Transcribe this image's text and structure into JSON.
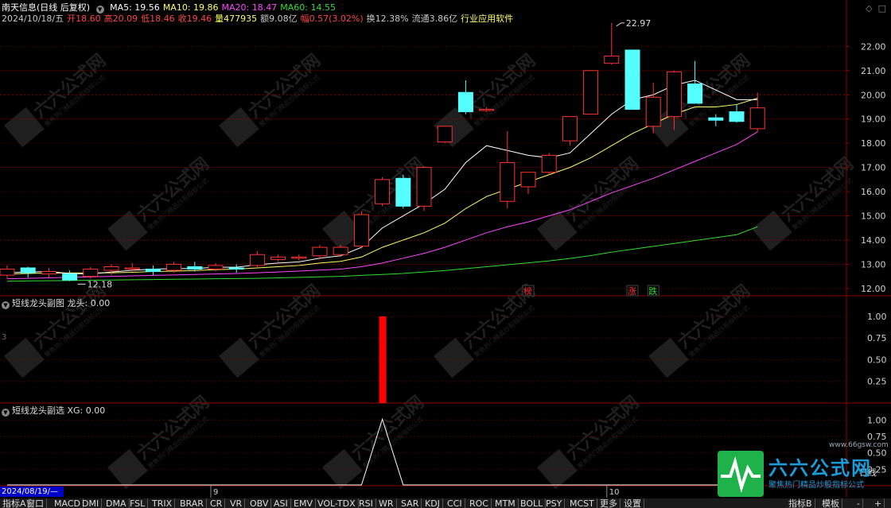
{
  "header": {
    "title": "南天信息(日线 后复权)",
    "ma": [
      {
        "label": "MA5: 19.56",
        "color": "#ffffff"
      },
      {
        "label": "MA10: 19.86",
        "color": "#ffff66"
      },
      {
        "label": "MA20: 18.47",
        "color": "#ff44ff"
      },
      {
        "label": "MA60: 14.55",
        "color": "#33dd33"
      }
    ],
    "line2": [
      {
        "label": "2024/10/18/五",
        "color": "#c8c8c8"
      },
      {
        "label": "开18.60",
        "color": "#ff4444"
      },
      {
        "label": "高20.09",
        "color": "#ff4444"
      },
      {
        "label": "低18.46",
        "color": "#ff4444"
      },
      {
        "label": "收19.46",
        "color": "#ff4444"
      },
      {
        "label": "量477935",
        "color": "#ffff66"
      },
      {
        "label": "额9.08亿",
        "color": "#c8c8c8"
      },
      {
        "label": "幅0.57(3.02%)",
        "color": "#ff4444"
      },
      {
        "label": "换12.38%",
        "color": "#c8c8c8"
      },
      {
        "label": "流通3.86亿",
        "color": "#c8c8c8"
      },
      {
        "label": "行业应用软件",
        "color": "#ffff66"
      }
    ]
  },
  "corner_icons": [
    "◇",
    "□"
  ],
  "sub1": {
    "title": "短线龙头副图",
    "value": "龙头: 0.00",
    "left_mark": "3"
  },
  "sub2": {
    "title": "短线龙头副选",
    "value": "XG: 0.00"
  },
  "price_labels": {
    "high": "22.97",
    "low": "12.18"
  },
  "markers": [
    {
      "text": "榜",
      "color": "#ff3333",
      "at": 25
    },
    {
      "text": "涨",
      "color": "#ff3333",
      "at": 30
    },
    {
      "text": "跌",
      "color": "#33dd33",
      "at": 31
    }
  ],
  "date_box": "2024/08/19/—",
  "month_labels": [
    {
      "text": "9",
      "at": 10
    },
    {
      "text": "10",
      "at": 29
    }
  ],
  "daily_label": "日线",
  "tabs": [
    "指标A",
    "窗口",
    "MACD",
    "DMI",
    "DMA",
    "FSL",
    "TRIX",
    "BRAR",
    "CR",
    "VR",
    "OBV",
    "ASI",
    "EMV",
    "VOL-TDX",
    "RSI",
    "WR",
    "SAR",
    "KDJ",
    "CCI",
    "ROC",
    "MTM",
    "BOLL",
    "PSY",
    "MCST",
    "更多",
    "设置"
  ],
  "right_tabs": [
    "指标B",
    "模板"
  ],
  "logo": {
    "main": "六六公式网",
    "sub": "聚焦热门精品炒股指标公式",
    "url": "www.66gsw.com"
  },
  "watermark": {
    "main": "六六公式网",
    "sub": "聚焦热门精品炒股指标公式"
  },
  "colors": {
    "up": "#ff3333",
    "down": "#55ffff",
    "bg": "#000000",
    "grid": "#8b0000"
  },
  "chart_data": [
    {
      "type": "candlestick",
      "ylim": [
        11.7,
        22.8
      ],
      "yticks": [
        12.0,
        13.0,
        14.0,
        15.0,
        16.0,
        17.0,
        18.0,
        19.0,
        20.0,
        21.0,
        22.0
      ],
      "ohlc": [
        [
          12.55,
          12.95,
          12.4,
          12.8
        ],
        [
          12.85,
          12.9,
          12.45,
          12.65
        ],
        [
          12.6,
          12.85,
          12.45,
          12.7
        ],
        [
          12.6,
          12.75,
          12.3,
          12.35
        ],
        [
          12.5,
          12.9,
          12.4,
          12.8
        ],
        [
          12.75,
          13.0,
          12.55,
          12.9
        ],
        [
          12.8,
          13.05,
          12.7,
          12.85
        ],
        [
          12.8,
          12.95,
          12.55,
          12.7
        ],
        [
          12.75,
          13.1,
          12.65,
          13.0
        ],
        [
          12.9,
          13.1,
          12.7,
          12.8
        ],
        [
          12.8,
          13.05,
          12.7,
          12.95
        ],
        [
          12.85,
          13.0,
          12.65,
          12.8
        ],
        [
          12.95,
          13.55,
          12.85,
          13.4
        ],
        [
          13.2,
          13.4,
          13.1,
          13.3
        ],
        [
          13.25,
          13.4,
          13.15,
          13.3
        ],
        [
          13.35,
          13.8,
          13.2,
          13.7
        ],
        [
          13.4,
          13.8,
          13.3,
          13.7
        ],
        [
          13.75,
          15.2,
          13.65,
          15.05
        ],
        [
          15.5,
          16.6,
          15.4,
          16.5
        ],
        [
          16.55,
          16.7,
          15.3,
          15.4
        ],
        [
          15.4,
          17.05,
          15.2,
          17.0
        ],
        [
          18.05,
          18.7,
          18.0,
          18.7
        ],
        [
          20.1,
          20.6,
          19.2,
          19.3
        ],
        [
          19.35,
          19.5,
          19.3,
          19.4
        ],
        [
          15.6,
          18.5,
          15.3,
          17.2
        ],
        [
          16.2,
          16.8,
          15.9,
          16.8
        ],
        [
          16.8,
          17.6,
          16.7,
          17.5
        ],
        [
          18.1,
          19.1,
          17.9,
          19.1
        ],
        [
          19.2,
          21.0,
          19.2,
          21.0
        ],
        [
          21.3,
          22.97,
          21.25,
          21.6
        ],
        [
          21.85,
          21.85,
          19.4,
          19.4
        ],
        [
          18.7,
          20.5,
          18.4,
          19.9
        ],
        [
          19.1,
          21.0,
          18.55,
          20.95
        ],
        [
          20.45,
          21.4,
          19.75,
          19.65
        ],
        [
          19.05,
          19.2,
          18.7,
          18.95
        ],
        [
          19.3,
          19.6,
          18.85,
          18.9
        ],
        [
          18.6,
          20.09,
          18.46,
          19.46
        ]
      ],
      "ma5": [
        12.65,
        12.68,
        12.7,
        12.62,
        12.6,
        12.68,
        12.75,
        12.8,
        12.82,
        12.82,
        12.88,
        12.88,
        12.98,
        13.05,
        13.1,
        13.25,
        13.35,
        13.7,
        14.5,
        15.0,
        15.5,
        16.1,
        17.2,
        17.9,
        17.7,
        17.5,
        17.4,
        17.6,
        18.4,
        19.2,
        19.8,
        20.0,
        20.4,
        20.6,
        20.2,
        19.8,
        19.8
      ],
      "ma10": [
        12.6,
        12.62,
        12.64,
        12.64,
        12.64,
        12.65,
        12.67,
        12.7,
        12.72,
        12.74,
        12.78,
        12.8,
        12.85,
        12.9,
        12.95,
        13.05,
        13.12,
        13.3,
        13.7,
        14.0,
        14.3,
        14.7,
        15.3,
        15.8,
        16.1,
        16.4,
        16.7,
        17.0,
        17.4,
        17.9,
        18.4,
        18.8,
        19.2,
        19.5,
        19.5,
        19.6,
        19.86
      ],
      "ma20": [
        12.4,
        12.42,
        12.44,
        12.46,
        12.48,
        12.5,
        12.52,
        12.54,
        12.56,
        12.58,
        12.6,
        12.62,
        12.65,
        12.68,
        12.72,
        12.76,
        12.8,
        12.9,
        13.05,
        13.25,
        13.45,
        13.7,
        14.0,
        14.3,
        14.55,
        14.75,
        15.0,
        15.25,
        15.6,
        15.95,
        16.25,
        16.55,
        16.9,
        17.25,
        17.6,
        17.95,
        18.47
      ],
      "ma60": [
        12.3,
        12.31,
        12.32,
        12.33,
        12.34,
        12.35,
        12.36,
        12.37,
        12.38,
        12.39,
        12.4,
        12.41,
        12.42,
        12.44,
        12.46,
        12.48,
        12.5,
        12.54,
        12.58,
        12.62,
        12.68,
        12.74,
        12.82,
        12.9,
        12.98,
        13.06,
        13.14,
        13.24,
        13.36,
        13.5,
        13.62,
        13.74,
        13.86,
        13.98,
        14.1,
        14.22,
        14.55
      ]
    },
    {
      "type": "bar",
      "ylim": [
        0,
        1.1
      ],
      "yticks": [
        1.0,
        0.75,
        0.5,
        0.25
      ],
      "values": [
        0,
        0,
        0,
        0,
        0,
        0,
        0,
        0,
        0,
        0,
        0,
        0,
        0,
        0,
        0,
        0,
        0,
        0,
        1,
        0,
        0,
        0,
        0,
        0,
        0,
        0,
        0,
        0,
        0,
        0,
        0,
        0,
        0,
        0,
        0,
        0,
        0
      ]
    },
    {
      "type": "line",
      "ylim": [
        0,
        1.1
      ],
      "yticks": [
        1.0,
        0.75,
        0.5,
        0.25
      ],
      "values": [
        0,
        0,
        0,
        0,
        0,
        0,
        0,
        0,
        0,
        0,
        0,
        0,
        0,
        0,
        0,
        0,
        0,
        0,
        1,
        0,
        0,
        0,
        0,
        0,
        0,
        0,
        0,
        0,
        0,
        0,
        0,
        0,
        0,
        0,
        0,
        0,
        0
      ]
    }
  ]
}
